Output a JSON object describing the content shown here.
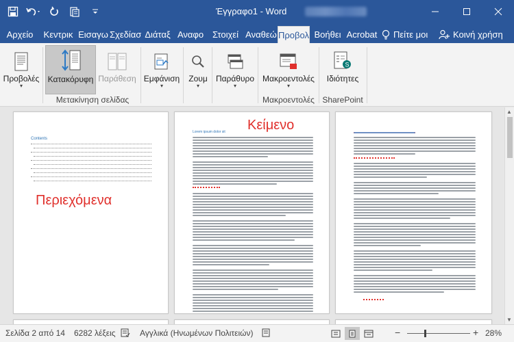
{
  "window": {
    "doc_title": "Έγγραφο1 - Word",
    "controls": {
      "minimize": "minimize-icon",
      "restore": "restore-icon",
      "close": "close-icon"
    }
  },
  "quick_access": [
    "save-icon",
    "undo-icon",
    "redo-icon",
    "touch-mode-icon",
    "customize-icon"
  ],
  "tabs": [
    "Αρχείο",
    "Κεντρικ",
    "Εισαγω",
    "Σχεδίασ",
    "Διάταξ",
    "Αναφο",
    "Στοιχεί",
    "Αναθεώ",
    "Προβολ",
    "Βοήθει",
    "Acrobat"
  ],
  "active_tab": "Προβολ",
  "tell_me": "Πείτε μοι",
  "share": "Κοινή χρήση",
  "ribbon": {
    "views": "Προβολές",
    "vertical": "Κατακόρυφη",
    "side_by_side": "Παράθεση",
    "page_movement_group": "Μετακίνηση σελίδας",
    "show": "Εμφάνιση",
    "zoom": "Ζουμ",
    "window": "Παράθυρο",
    "macros": "Μακροεντολές",
    "macros_group": "Μακροεντολές",
    "properties": "Ιδιότητες",
    "sharepoint_group": "SharePoint"
  },
  "pages": {
    "toc_heading": "Contents",
    "toc_annotation": "Περιεχόμενα",
    "text_annotation": "Κείμενο",
    "lorem_heading": "Lorem ipsum dolor sit"
  },
  "status": {
    "page": "Σελίδα 2 από 14",
    "words": "6282 λέξεις",
    "language": "Αγγλικά (Ηνωμένων Πολιτειών)",
    "zoom": "28%",
    "zoom_fraction": 0.28
  },
  "colors": {
    "brand": "#2b579a",
    "annotation": "#e0302c"
  }
}
